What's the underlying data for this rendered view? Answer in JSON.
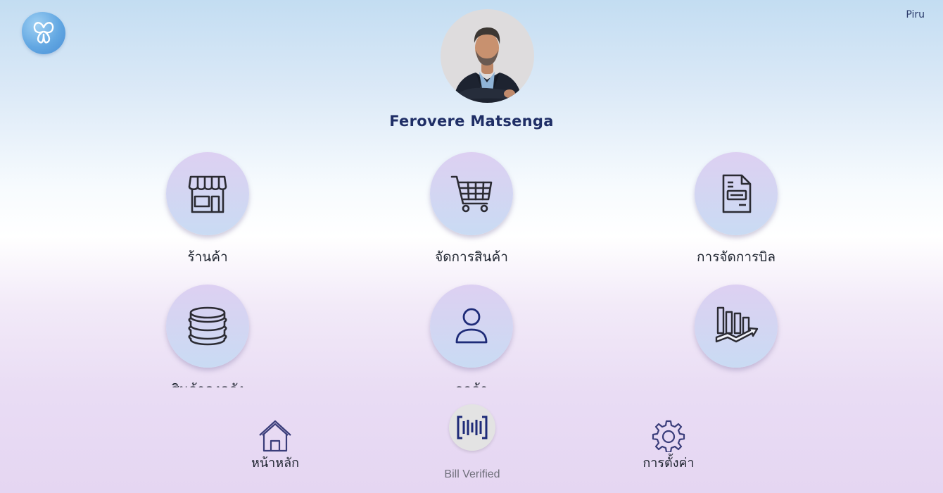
{
  "header": {
    "logo_icon": "butterfly-logo-icon",
    "user_short_name": "Piru"
  },
  "profile": {
    "avatar_icon": "user-photo",
    "name": "Ferovere Matsenga"
  },
  "menu": {
    "items": [
      {
        "label": "ร้านค้า",
        "icon": "storefront-icon"
      },
      {
        "label": "จัดการสินค้า",
        "icon": "shopping-cart-icon"
      },
      {
        "label": "การจัดการบิล",
        "icon": "bill-document-icon"
      },
      {
        "label": "สินค้าคงคลัง",
        "icon": "database-stack-icon"
      },
      {
        "label": "ลูกค้า",
        "icon": "user-icon"
      },
      {
        "label": "",
        "icon": "bar-chart-trend-icon"
      }
    ]
  },
  "bottom_nav": {
    "home_label": "หน้าหลัก",
    "settings_label": "การตั้งค่า",
    "scan_label": "Bill Verified"
  },
  "colors": {
    "accent_navy": "#1f2e66",
    "icon_stroke": "#2b2b33",
    "scan_icon": "#1e2b78",
    "tile_gradient_top": "#ddd0f2",
    "tile_gradient_bottom": "#c9dbf3"
  }
}
